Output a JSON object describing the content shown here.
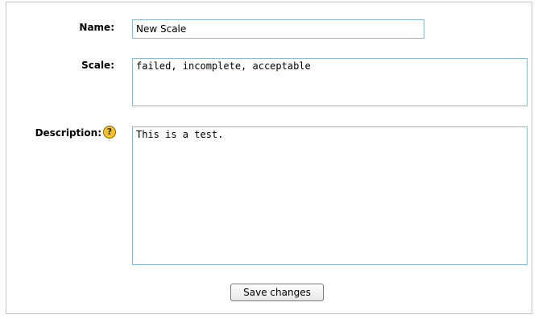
{
  "form": {
    "name_label": "Name:",
    "name_value": "New Scale",
    "scale_label": "Scale:",
    "scale_value": "failed, incomplete, acceptable",
    "description_label": "Description:",
    "description_value": "This is a test.",
    "help_icon": "help-icon",
    "help_glyph": "?",
    "save_label": "Save changes"
  }
}
